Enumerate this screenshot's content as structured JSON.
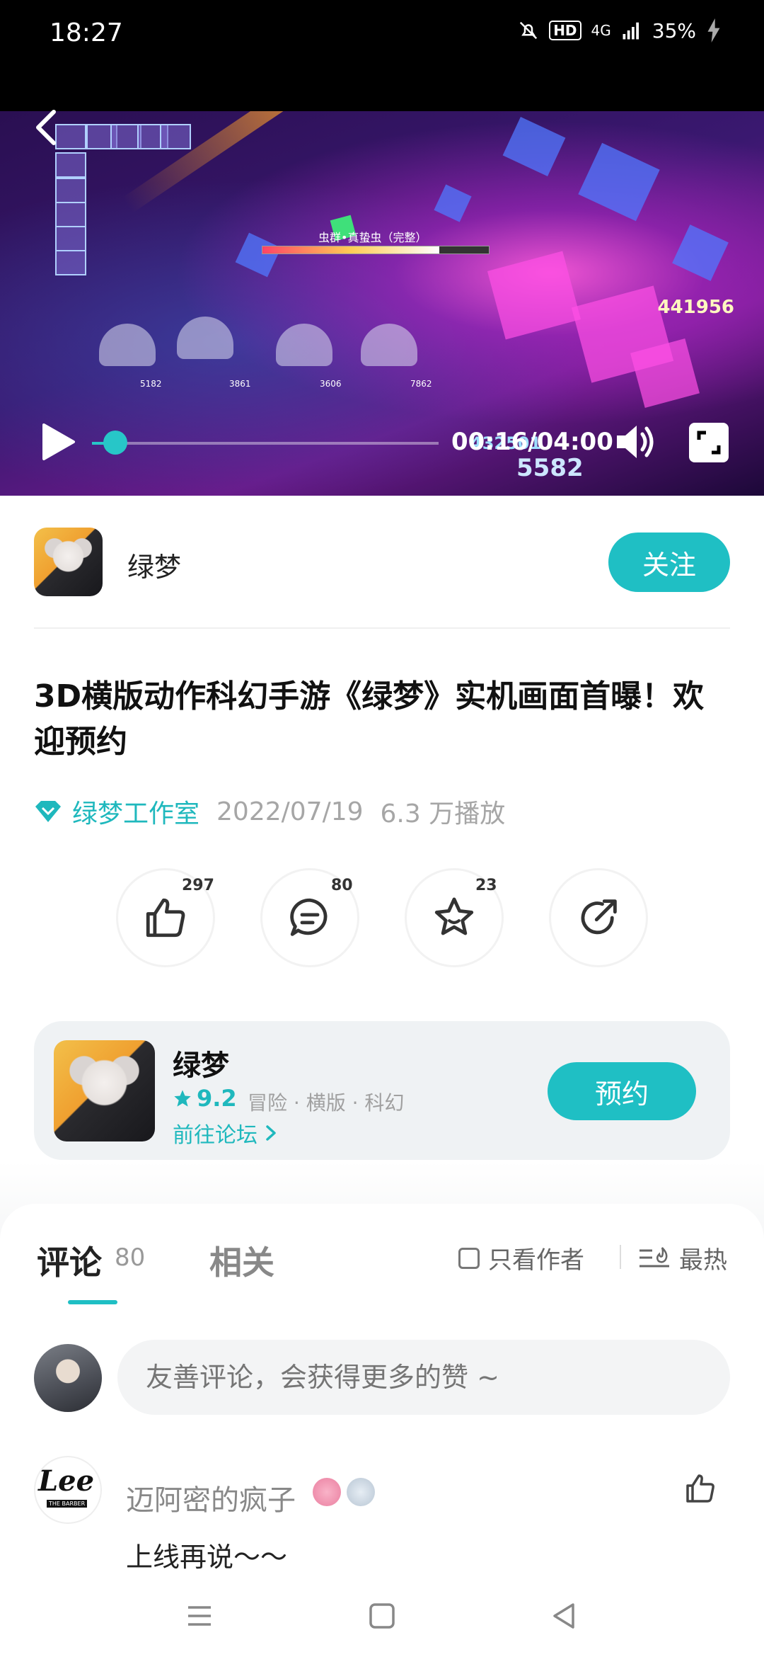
{
  "status_bar": {
    "time": "18:27",
    "hd": "HD",
    "network": "4G",
    "battery": "35%",
    "icons": [
      "bell-muted-icon",
      "hd-icon",
      "signal-icon",
      "battery-charging-icon"
    ]
  },
  "video": {
    "boss_name": "虫群•真蛰虫（完整）",
    "score": "441956",
    "damage_1": "432501",
    "damage_2": "5582",
    "hero_hp": [
      "5182",
      "3861",
      "3606",
      "7862"
    ],
    "time": "00:16/04:00",
    "progress_fraction": 0.067
  },
  "author": {
    "name": "绿梦",
    "follow_label": "关注"
  },
  "post": {
    "title": "3D横版动作科幻手游《绿梦》实机画面首曝！欢迎预约",
    "studio": "绿梦工作室",
    "date": "2022/07/19",
    "plays": "6.3 万播放"
  },
  "actions": {
    "like_count": "297",
    "comment_count": "80",
    "favorite_count": "23"
  },
  "game_card": {
    "name": "绿梦",
    "rating": "9.2",
    "tags": "冒险 · 横版 · 科幻",
    "forum_link": "前往论坛",
    "reserve_label": "预约"
  },
  "comments": {
    "tab_comments": "评论",
    "tab_comments_count": "80",
    "tab_related": "相关",
    "author_only": "只看作者",
    "sort": "最热",
    "input_placeholder": "友善评论，会获得更多的赞 ~",
    "items": [
      {
        "user": "迈阿密的疯子",
        "avatar_text": "Lee",
        "avatar_subtext": "THE BARBER",
        "text": "上线再说～～"
      }
    ]
  },
  "colors": {
    "accent": "#1fbfc4",
    "link": "#1fb8bd"
  }
}
